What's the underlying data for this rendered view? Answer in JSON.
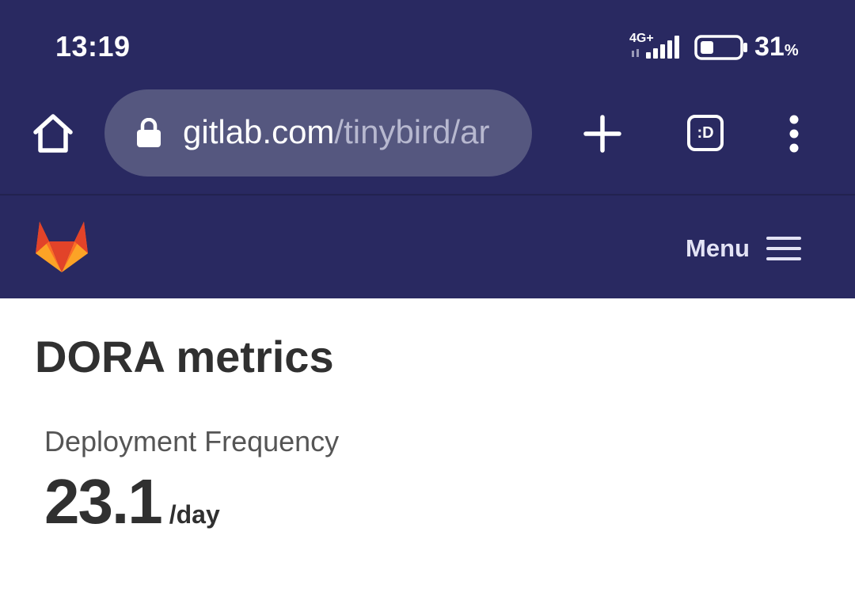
{
  "status_bar": {
    "time": "13:19",
    "network": "4G+",
    "battery_percent": "31",
    "battery_unit": "%",
    "battery_level": 0.31
  },
  "browser": {
    "url_domain": "gitlab.com",
    "url_path": "/tinybird/ar",
    "tabs_label": ":D",
    "icons": [
      "home-icon",
      "lock-icon",
      "plus-icon",
      "tab-switcher-icon",
      "overflow-menu-icon"
    ]
  },
  "site_header": {
    "logo": "gitlab-tanuki-logo",
    "menu_label": "Menu",
    "menu_icon": "hamburger-icon"
  },
  "main": {
    "title": "DORA metrics",
    "metric": {
      "label": "Deployment Frequency",
      "value": "23.1",
      "unit": "/day"
    }
  },
  "colors": {
    "header_bg": "#292961",
    "url_bar_bg": "#55577f",
    "text_dark": "#303030",
    "logo_orange": "#e24329",
    "logo_light_orange": "#fca326",
    "logo_mid_orange": "#fc6d26"
  }
}
